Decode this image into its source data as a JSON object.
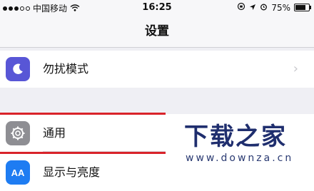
{
  "status_bar": {
    "carrier": "中国移动",
    "time": "16:25",
    "battery_text": "75%",
    "battery_level": 0.75,
    "signal_filled": 3,
    "signal_total": 5
  },
  "nav": {
    "title": "设置"
  },
  "rows": [
    {
      "label": "勿扰模式",
      "icon": "moon-icon",
      "icon_bg": "#5856d6"
    },
    {
      "label": "通用",
      "icon": "gear-icon",
      "icon_bg": "#8e8e93"
    },
    {
      "label": "显示与亮度",
      "icon": "display-brightness-icon",
      "icon_bg": "#1e7cf2",
      "icon_text": "AA"
    }
  ],
  "watermark": {
    "title": "下载之家",
    "url": "www.downza.cn"
  },
  "colors": {
    "accent_red": "#d9232a",
    "logo_blue": "#1f2e6e"
  }
}
